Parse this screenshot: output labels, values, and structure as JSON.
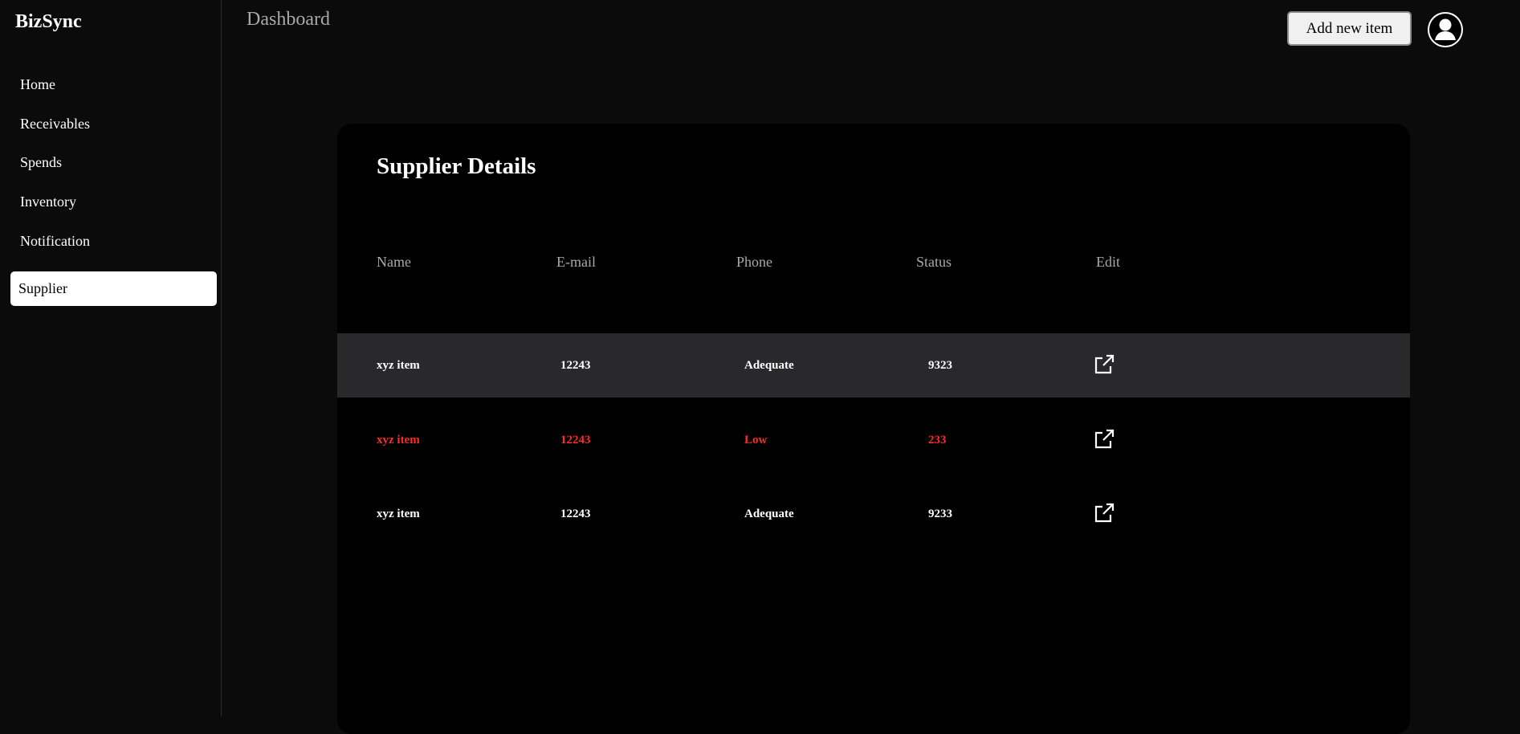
{
  "app": {
    "brand": "BizSync"
  },
  "sidebar": {
    "items": [
      {
        "label": "Home"
      },
      {
        "label": "Receivables"
      },
      {
        "label": "Spends"
      },
      {
        "label": "Inventory"
      },
      {
        "label": "Notification"
      },
      {
        "label": "Supplier",
        "active": true
      }
    ]
  },
  "header": {
    "title": "Dashboard",
    "add_button": "Add new item",
    "avatar_icon": "user-avatar-icon"
  },
  "card": {
    "title": "Supplier Details",
    "columns": [
      "Name",
      "E-mail",
      "Phone",
      "Status",
      "Edit"
    ],
    "rows": [
      {
        "name": "xyz item",
        "email": "12243",
        "phone": "Adequate",
        "status": "9323",
        "edit_icon": "external-link-icon",
        "highlighted": true
      },
      {
        "name": "xyz item",
        "email": "12243",
        "phone": "Low",
        "status": "233",
        "edit_icon": "external-link-icon",
        "alert": true
      },
      {
        "name": "xyz item",
        "email": "12243",
        "phone": "Adequate",
        "status": "9233",
        "edit_icon": "external-link-icon"
      }
    ]
  },
  "colors": {
    "background": "#0c0b0c",
    "card": "#000000",
    "highlight_row": "#29292b",
    "alert": "#ff2a2a",
    "muted_text": "#a9a9a9"
  }
}
